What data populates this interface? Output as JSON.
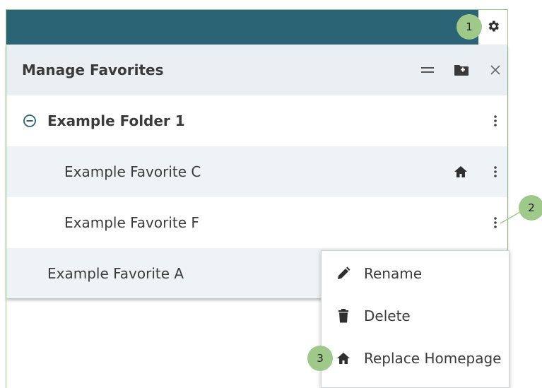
{
  "panel": {
    "title": "Manage Favorites"
  },
  "rows": [
    {
      "label": "Example Folder 1"
    },
    {
      "label": "Example Favorite C"
    },
    {
      "label": "Example Favorite F"
    },
    {
      "label": "Example Favorite A"
    }
  ],
  "context_menu": {
    "items": [
      {
        "label": "Rename",
        "icon": "pencil-icon"
      },
      {
        "label": "Delete",
        "icon": "trash-icon"
      },
      {
        "label": "Replace Homepage",
        "icon": "home-icon"
      }
    ]
  },
  "callouts": [
    "1",
    "2",
    "3"
  ],
  "colors": {
    "topbar": "#2b6474",
    "header_bg": "#e9eff3",
    "row_alt": "#eef3f6",
    "callout": "#9ec98a",
    "icon": "#3b3b3b",
    "folder_icon": "#2b6474"
  }
}
